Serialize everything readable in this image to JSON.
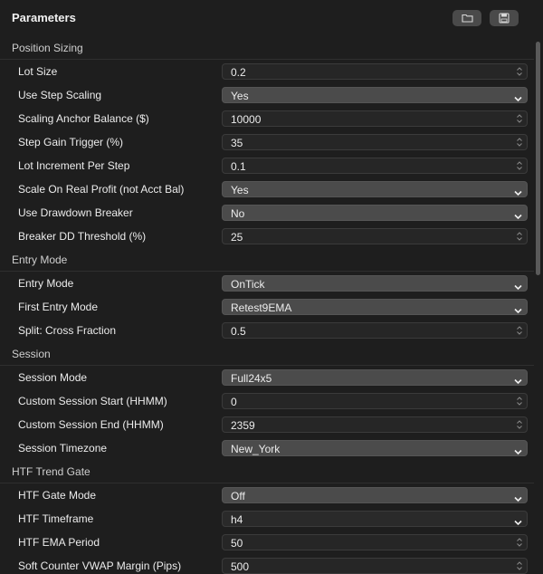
{
  "header": {
    "title": "Parameters",
    "buttons": [
      {
        "icon": "folder-icon"
      },
      {
        "icon": "save-icon"
      }
    ]
  },
  "sections": [
    {
      "title": "Position Sizing",
      "rows": [
        {
          "label": "Lot Size",
          "value": "0.2",
          "kind": "number"
        },
        {
          "label": "Use Step Scaling",
          "value": "Yes",
          "kind": "select"
        },
        {
          "label": "Scaling Anchor Balance ($)",
          "value": "10000",
          "kind": "number"
        },
        {
          "label": "Step Gain Trigger (%)",
          "value": "35",
          "kind": "number"
        },
        {
          "label": "Lot Increment Per Step",
          "value": "0.1",
          "kind": "number"
        },
        {
          "label": "Scale On Real Profit (not Acct Bal)",
          "value": "Yes",
          "kind": "select"
        },
        {
          "label": "Use Drawdown Breaker",
          "value": "No",
          "kind": "select"
        },
        {
          "label": "Breaker DD Threshold (%)",
          "value": "25",
          "kind": "number"
        }
      ]
    },
    {
      "title": "Entry Mode",
      "rows": [
        {
          "label": "Entry Mode",
          "value": "OnTick",
          "kind": "select"
        },
        {
          "label": "First Entry Mode",
          "value": "Retest9EMA",
          "kind": "select"
        },
        {
          "label": "Split: Cross Fraction",
          "value": "0.5",
          "kind": "number"
        }
      ]
    },
    {
      "title": "Session",
      "rows": [
        {
          "label": "Session Mode",
          "value": "Full24x5",
          "kind": "select"
        },
        {
          "label": "Custom Session Start (HHMM)",
          "value": "0",
          "kind": "number"
        },
        {
          "label": "Custom Session End (HHMM)",
          "value": "2359",
          "kind": "number"
        },
        {
          "label": "Session Timezone",
          "value": "New_York",
          "kind": "select"
        }
      ]
    },
    {
      "title": "HTF Trend Gate",
      "rows": [
        {
          "label": "HTF Gate Mode",
          "value": "Off",
          "kind": "select"
        },
        {
          "label": "HTF Timeframe",
          "value": "h4",
          "kind": "select-dark"
        },
        {
          "label": "HTF EMA Period",
          "value": "50",
          "kind": "number"
        },
        {
          "label": "Soft Counter VWAP Margin (Pips)",
          "value": "500",
          "kind": "number"
        }
      ]
    }
  ]
}
